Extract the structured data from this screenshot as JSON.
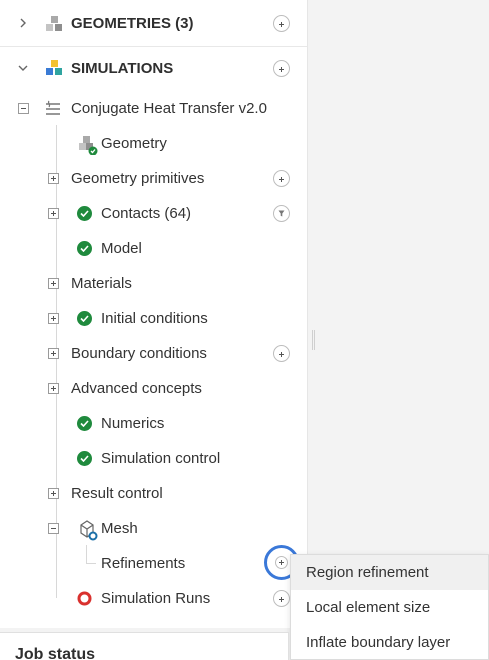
{
  "tree": {
    "geometries": {
      "label": "GEOMETRIES (3)",
      "icon": "cubes-icon"
    },
    "simulations": {
      "label": "SIMULATIONS",
      "icon": "cubes-colored-icon"
    },
    "simulation": {
      "label": "Conjugate Heat Transfer v2.0",
      "icon": "heat-transfer-icon"
    },
    "items": [
      {
        "label": "Geometry"
      },
      {
        "label": "Geometry primitives"
      },
      {
        "label": "Contacts (64)"
      },
      {
        "label": "Model"
      },
      {
        "label": "Materials"
      },
      {
        "label": "Initial conditions"
      },
      {
        "label": "Boundary conditions"
      },
      {
        "label": "Advanced concepts"
      },
      {
        "label": "Numerics"
      },
      {
        "label": "Simulation control"
      },
      {
        "label": "Result control"
      },
      {
        "label": "Mesh"
      },
      {
        "label": "Refinements"
      },
      {
        "label": "Simulation Runs"
      }
    ]
  },
  "context_menu": {
    "items": [
      {
        "label": "Region refinement"
      },
      {
        "label": "Local element size"
      },
      {
        "label": "Inflate boundary layer"
      }
    ]
  },
  "job_status": {
    "label": "Job status"
  },
  "colors": {
    "check": "#1f8a3d",
    "focus": "#3a78d8",
    "error": "#d9312e"
  }
}
